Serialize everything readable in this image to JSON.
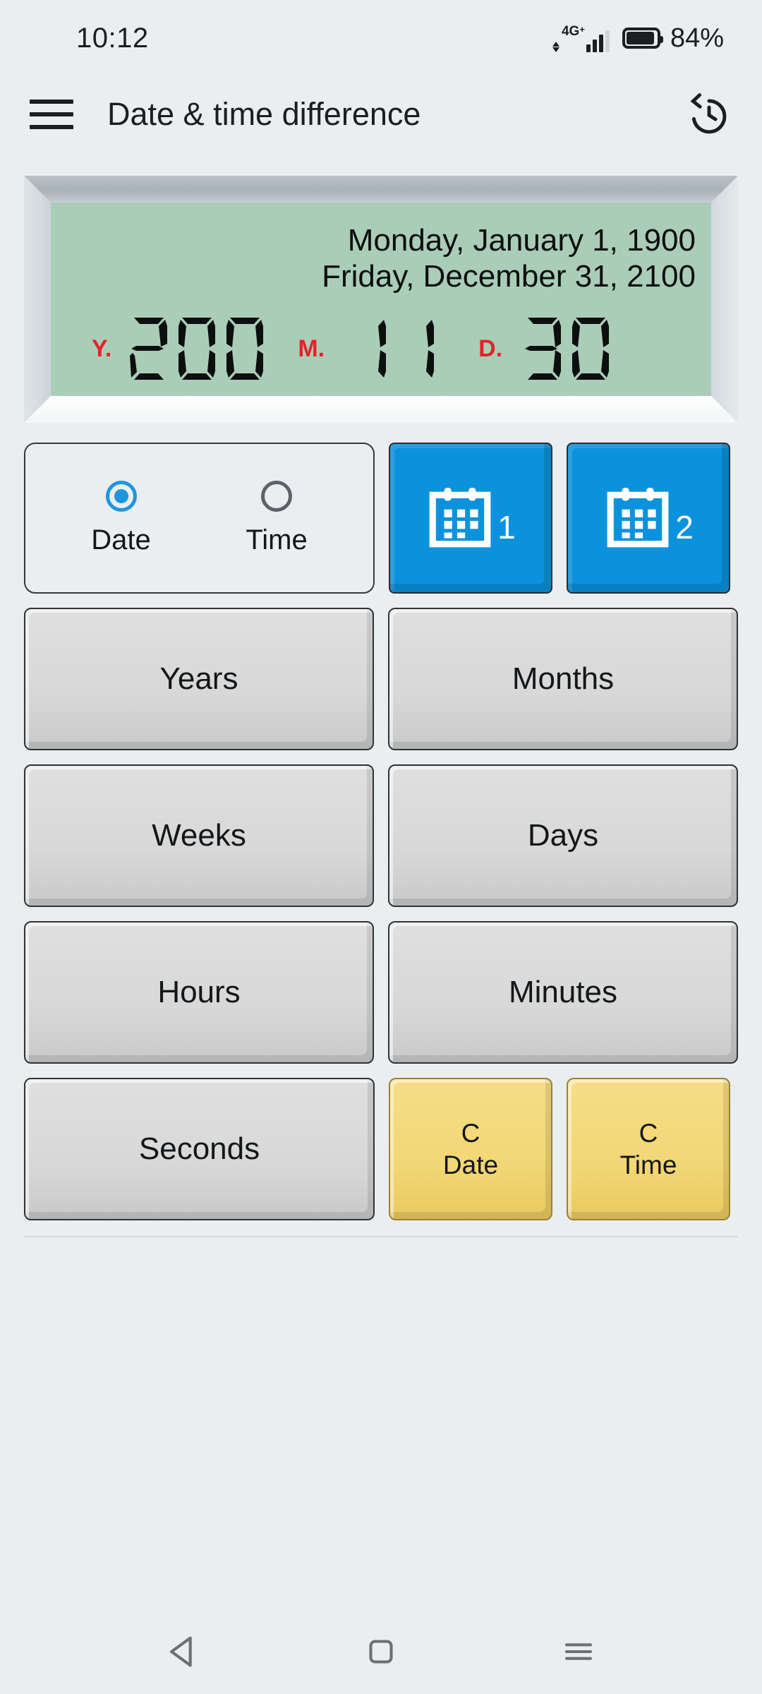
{
  "status_bar": {
    "clock": "10:12",
    "network_label": "4G",
    "network_superscript": "+",
    "battery_percent": "84%",
    "battery_level": 84,
    "icons": [
      "data-arrows-icon",
      "signal-bars-icon",
      "battery-icon"
    ]
  },
  "app_bar": {
    "menu_icon": "hamburger-menu-icon",
    "title": "Date & time difference",
    "action_icon": "history-icon"
  },
  "display": {
    "date_line_1": "Monday, January 1, 1900",
    "date_line_2": "Friday, December 31, 2100",
    "screen_color": "#aacdb7",
    "unit_color": "#e5222a",
    "segments": [
      {
        "unit": "Y.",
        "value": "200"
      },
      {
        "unit": "M.",
        "value": "11"
      },
      {
        "unit": "D.",
        "value": "30"
      }
    ]
  },
  "mode_selector": {
    "options": [
      {
        "label": "Date",
        "selected": true
      },
      {
        "label": "Time",
        "selected": false
      }
    ],
    "accent_color": "#1e96dd"
  },
  "calendar_buttons": [
    {
      "icon": "calendar-icon",
      "number": "1",
      "color": "#0c92dd"
    },
    {
      "icon": "calendar-icon",
      "number": "2",
      "color": "#0c92dd"
    }
  ],
  "unit_buttons": [
    {
      "label": "Years"
    },
    {
      "label": "Months"
    },
    {
      "label": "Weeks"
    },
    {
      "label": "Days"
    },
    {
      "label": "Hours"
    },
    {
      "label": "Minutes"
    },
    {
      "label": "Seconds"
    }
  ],
  "clear_buttons": [
    {
      "line1": "C",
      "line2": "Date",
      "color": "#f2d776"
    },
    {
      "line1": "C",
      "line2": "Time",
      "color": "#f2d776"
    }
  ],
  "nav_bar": {
    "back_icon": "triangle-back-icon",
    "home_icon": "square-home-icon",
    "recents_icon": "hamburger-recents-icon"
  }
}
